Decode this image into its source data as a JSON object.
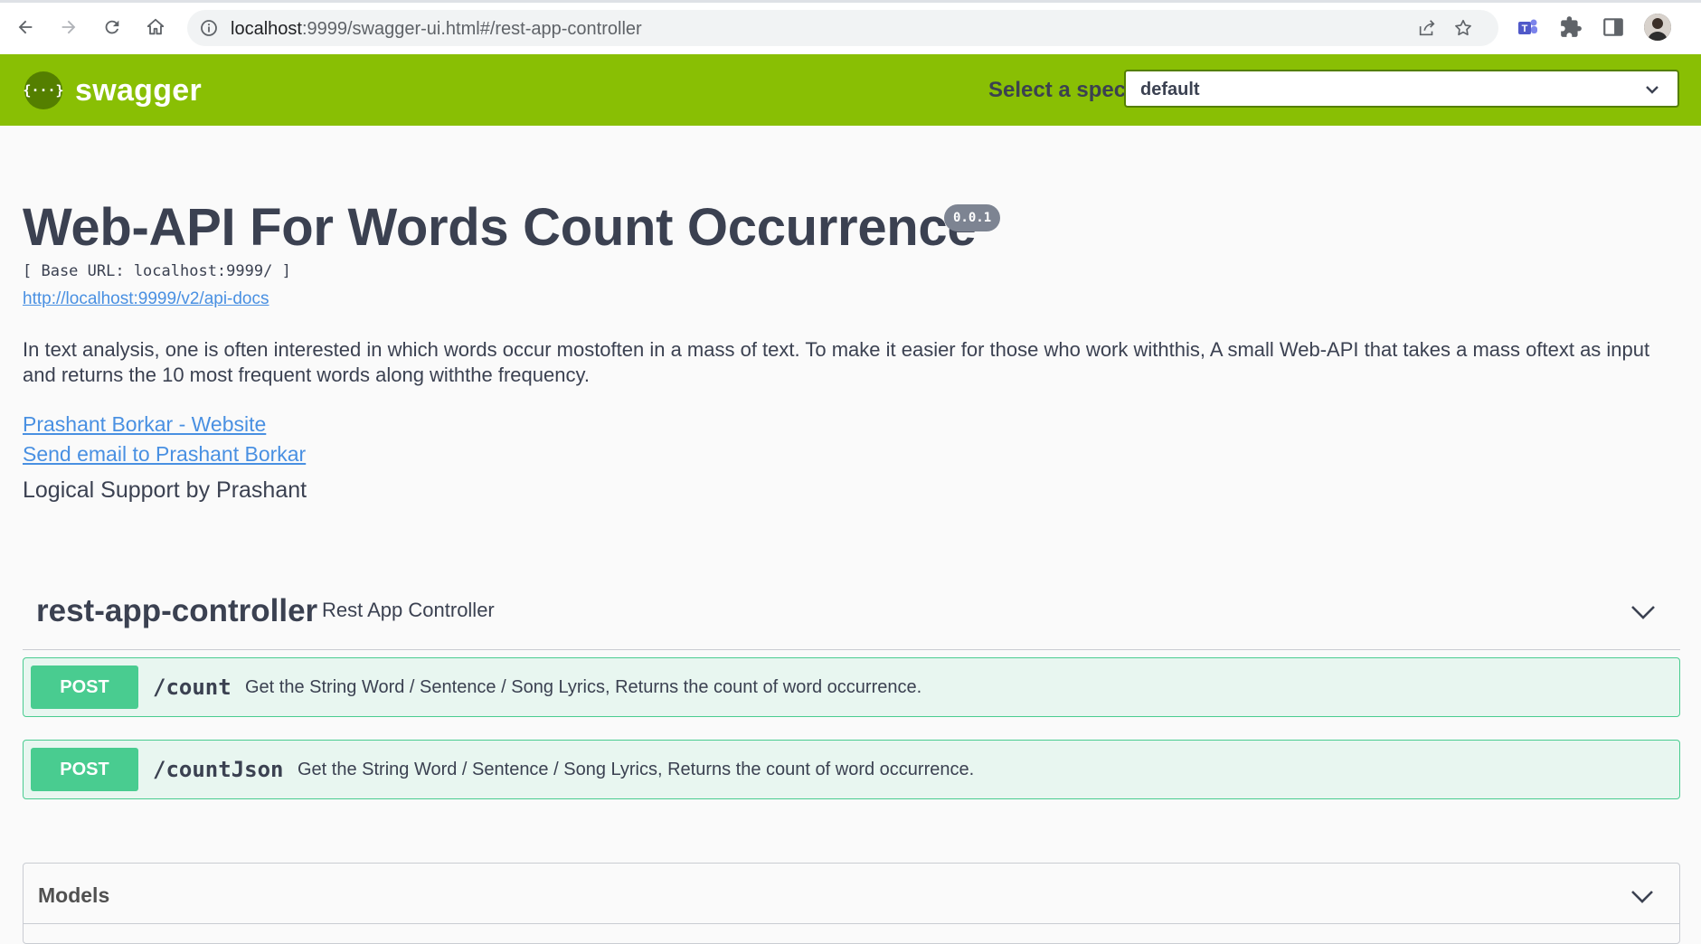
{
  "browser": {
    "url_host": "localhost",
    "url_path": ":9999/swagger-ui.html#/rest-app-controller"
  },
  "topbar": {
    "logo_mark": "{···}",
    "logo_text": "swagger",
    "spec_label": "Select a spec",
    "spec_selected": "default"
  },
  "info": {
    "title": "Web-API For Words Count Occurrence",
    "version": "0.0.1",
    "base_url": "[ Base URL: localhost:9999/ ]",
    "api_docs_link": "http://localhost:9999/v2/api-docs",
    "description": "In text analysis, one is often interested in which words occur mostoften in a mass of text. To make it easier for those who work withthis, A small Web-API that takes a mass oftext as input and returns the 10 most frequent words along withthe frequency.",
    "website_link": "Prashant Borkar - Website",
    "email_link": "Send email to Prashant Borkar",
    "support_text": "Logical Support by Prashant"
  },
  "tag": {
    "name": "rest-app-controller",
    "description": "Rest App Controller"
  },
  "operations": [
    {
      "method": "POST",
      "path": "/count",
      "summary": "Get the String Word / Sentence / Song Lyrics, Returns the count of word occurrence."
    },
    {
      "method": "POST",
      "path": "/countJson",
      "summary": "Get the String Word / Sentence / Song Lyrics, Returns the count of word occurrence."
    }
  ],
  "models": {
    "title": "Models"
  },
  "colors": {
    "topbar": "#89bf04",
    "post": "#49cc90",
    "post_bg": "#e8f6f0",
    "link": "#4990e2",
    "text": "#3b4151"
  }
}
